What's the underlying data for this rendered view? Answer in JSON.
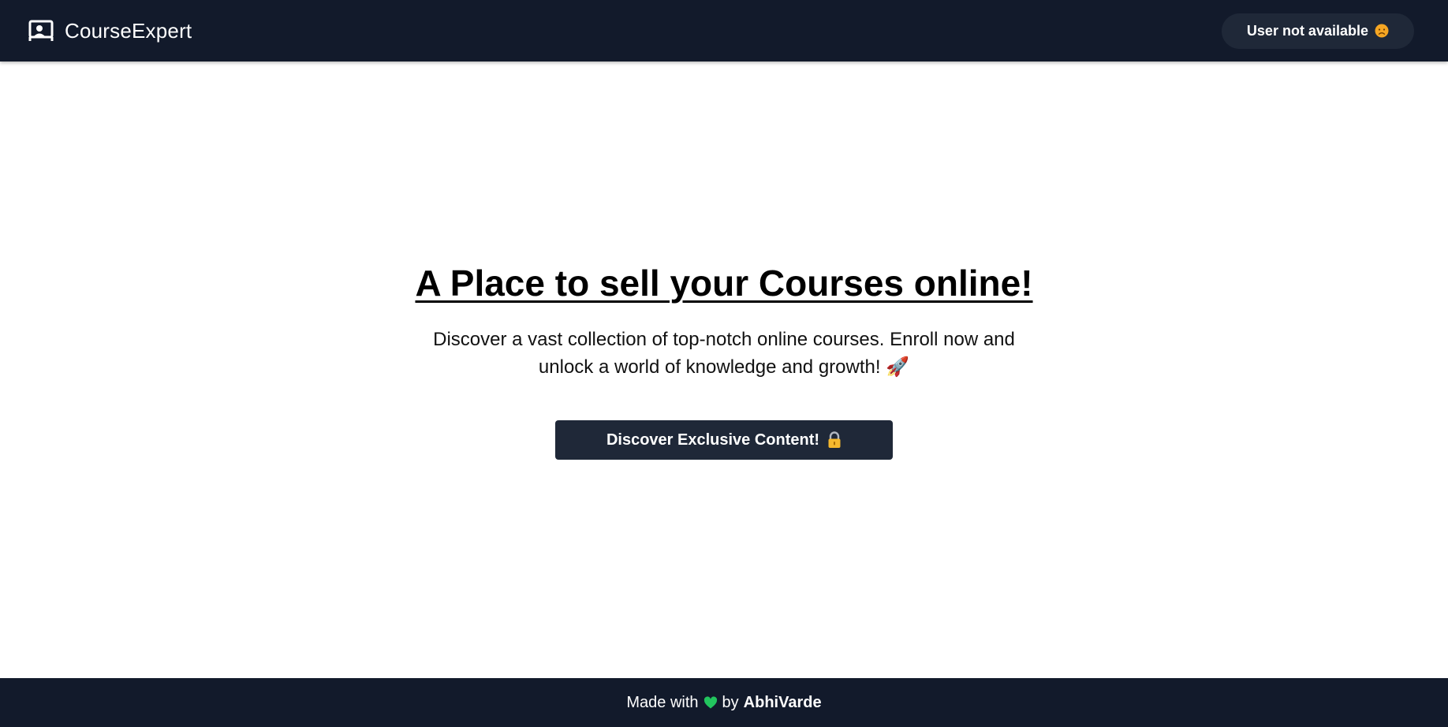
{
  "navbar": {
    "brand_name": "CourseExpert",
    "brand_icon": "presentation-board-icon",
    "user_status": "User not available",
    "user_status_icon": "sad-face-icon"
  },
  "hero": {
    "title": "A Place to sell your Courses online!",
    "description": "Discover a vast collection of top-notch online courses. Enroll now and unlock a world of knowledge and growth! 🚀",
    "cta_label": "Discover Exclusive Content!",
    "cta_icon": "lock-icon"
  },
  "footer": {
    "made_with": "Made with",
    "heart_icon": "green-heart-icon",
    "by": "by",
    "author": "AbhiVarde"
  },
  "colors": {
    "navbar_bg": "#121a2b",
    "button_bg": "#1f2838",
    "heart": "#22c55e",
    "sad_face": "#f5a623"
  }
}
